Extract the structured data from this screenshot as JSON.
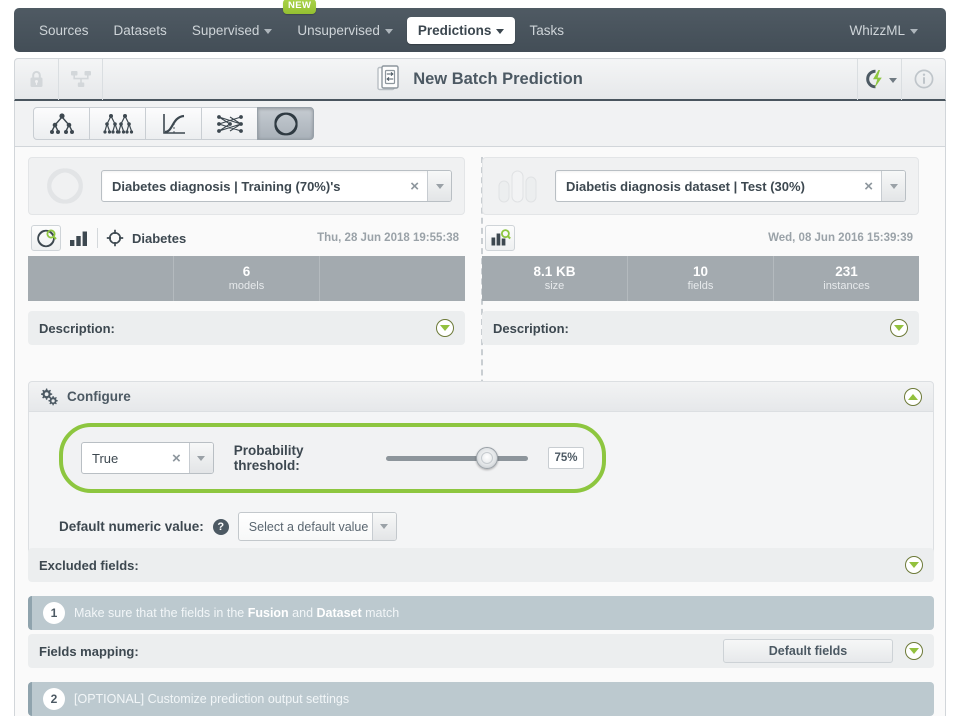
{
  "nav": {
    "items": [
      {
        "label": "Sources",
        "caret": false,
        "active": false
      },
      {
        "label": "Datasets",
        "caret": false,
        "active": false
      },
      {
        "label": "Supervised",
        "caret": true,
        "active": false
      },
      {
        "label": "Unsupervised",
        "caret": true,
        "active": false
      },
      {
        "label": "Predictions",
        "caret": true,
        "active": true
      },
      {
        "label": "Tasks",
        "caret": false,
        "active": false
      }
    ],
    "badge": "NEW",
    "account": "WhizzML"
  },
  "header": {
    "title": "New Batch Prediction",
    "lock_icon": "lock-icon",
    "share_icon": "share-icon",
    "doc_icon": "batch-prediction-icon",
    "flash_icon": "flash-icon",
    "info_icon": "info-icon"
  },
  "typebar": {
    "buttons": [
      {
        "name": "model",
        "icon": "decision-tree-icon",
        "selected": false
      },
      {
        "name": "ensemble",
        "icon": "ensemble-icon",
        "selected": false
      },
      {
        "name": "logistic-regression",
        "icon": "logistic-regression-icon",
        "selected": false
      },
      {
        "name": "deepnet",
        "icon": "deepnet-icon",
        "selected": false
      },
      {
        "name": "fusion",
        "icon": "fusion-icon",
        "selected": true
      }
    ]
  },
  "left_panel": {
    "resource_icon": "fusion-icon",
    "selected": "Diabetes diagnosis | Training (70%)'s",
    "clear": "×",
    "view_icon": "fusion-search-icon",
    "chart_icon": "histogram-icon",
    "objective_icon": "objective-target-icon",
    "objective_name": "Diabetes",
    "date": "Thu, 28 Jun 2018 19:55:38",
    "stats": [
      {
        "value": "",
        "label": ""
      },
      {
        "value": "6",
        "label": "models"
      },
      {
        "value": "",
        "label": ""
      }
    ],
    "description_label": "Description:"
  },
  "right_panel": {
    "resource_icon": "dataset-icon",
    "selected": "Diabetis diagnosis dataset | Test (30%)",
    "clear": "×",
    "view_icon": "dataset-search-icon",
    "date": "Wed, 08 Jun 2016 15:39:39",
    "stats": [
      {
        "value": "8.1 KB",
        "label": "size"
      },
      {
        "value": "10",
        "label": "fields"
      },
      {
        "value": "231",
        "label": "instances"
      }
    ],
    "description_label": "Description:"
  },
  "configure": {
    "title": "Configure",
    "gear_icon": "gears-icon",
    "collapse_icon": "collapse-up-icon",
    "positive_class": {
      "value": "True",
      "clear": "×"
    },
    "threshold": {
      "label": "Probability threshold:",
      "value": "75%",
      "percent": 75
    },
    "default_numeric": {
      "label": "Default numeric value:",
      "help_icon": "help-icon",
      "placeholder": "Select a default value"
    }
  },
  "sections": {
    "excluded_fields": {
      "label": "Excluded fields:",
      "expand_icon": "expand-down-icon"
    },
    "step1": {
      "num": "1",
      "text_before": "Make sure that the fields in the ",
      "bold1": "Fusion",
      "text_mid": " and ",
      "bold2": "Dataset",
      "text_after": " match"
    },
    "fields_mapping": {
      "label": "Fields mapping:",
      "button": "Default fields",
      "expand_icon": "expand-down-icon"
    },
    "step2": {
      "num": "2",
      "text": "[OPTIONAL] Customize prediction output settings"
    }
  },
  "colors": {
    "nav_bg": "#48545d",
    "accent_green": "#8dc63f",
    "badge_green": "#9fca3b",
    "stat_bg": "#a3aaaf",
    "step_bg": "#bcc9cf"
  }
}
